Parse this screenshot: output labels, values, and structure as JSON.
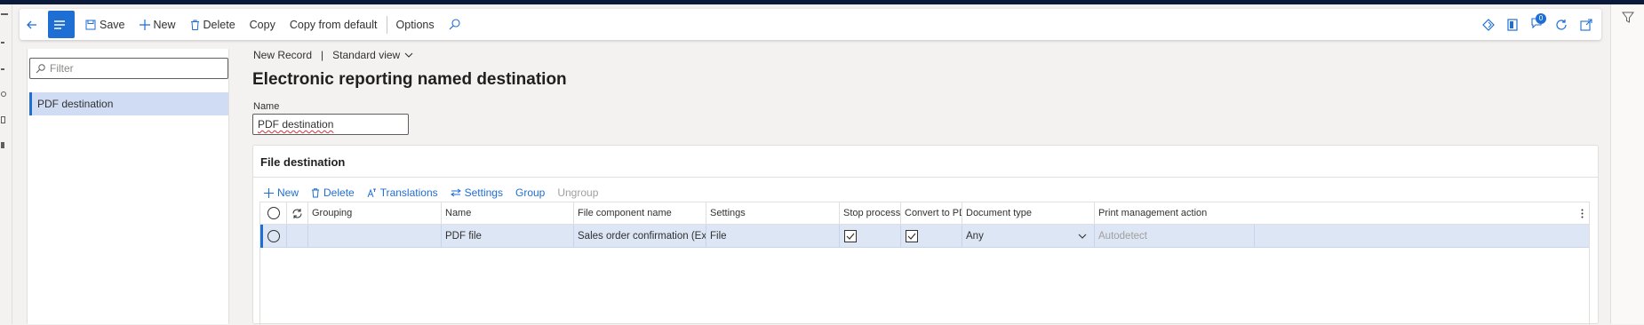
{
  "actionbar": {
    "save": "Save",
    "new": "New",
    "delete": "Delete",
    "copy": "Copy",
    "copy_from_default": "Copy from default",
    "options": "Options",
    "notification_count": "0"
  },
  "listpane": {
    "filter_placeholder": "Filter",
    "items": [
      "PDF destination"
    ]
  },
  "breadcrumb": {
    "record": "New Record",
    "separator": "|",
    "view": "Standard view"
  },
  "page": {
    "title": "Electronic reporting named destination"
  },
  "name_field": {
    "label": "Name",
    "value": "PDF destination"
  },
  "section": {
    "title": "File destination",
    "toolbar": {
      "new": "New",
      "delete": "Delete",
      "translations": "Translations",
      "settings": "Settings",
      "group": "Group",
      "ungroup": "Ungroup"
    }
  },
  "grid": {
    "columns": {
      "grouping": "Grouping",
      "name": "Name",
      "file_component_name": "File component name",
      "settings": "Settings",
      "stop_processing": "Stop processing...",
      "convert_to_pdf": "Convert to PDF",
      "document_type": "Document type",
      "print_management_action": "Print management action"
    },
    "rows": [
      {
        "grouping": "",
        "name": "PDF file",
        "file_component_name": "Sales order confirmation (Ex...",
        "settings": "File",
        "stop_processing": true,
        "convert_to_pdf": true,
        "document_type": "Any",
        "print_management_action": "Autodetect"
      }
    ]
  },
  "colors": {
    "accent": "#1f6ed4",
    "selected_row": "#dce6f5",
    "list_selected": "#cfdcf3",
    "top_strip": "#0b1a3a"
  }
}
